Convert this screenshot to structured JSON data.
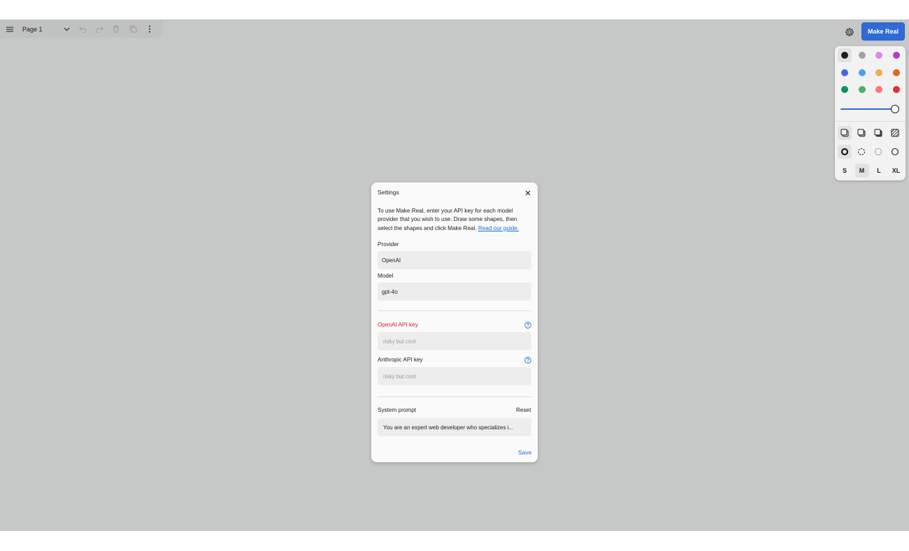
{
  "menu_bar": {
    "page_name": "Page 1"
  },
  "top_right": {
    "make_real_label": "Make Real"
  },
  "style_panel": {
    "colors": [
      "#1d1d1d",
      "#9ea3a8",
      "#e085e6",
      "#ae3ec9",
      "#4465e9",
      "#4ba1f1",
      "#f1ac4b",
      "#e16919",
      "#099268",
      "#4cb05e",
      "#f87777",
      "#e03131"
    ],
    "selected_color_index": 0,
    "opacity_level": 1.0,
    "sizes": [
      "S",
      "M",
      "L",
      "XL"
    ],
    "selected_size": "M"
  },
  "dialog": {
    "title": "Settings",
    "intro_text": "To use Make Real, enter your API key for each model provider that you wish to use. Draw some shapes, then select the shapes and click Make Real. ",
    "guide_link": "Read our guide.",
    "provider_label": "Provider",
    "provider_value": "OpenAI",
    "model_label": "Model",
    "model_value": "gpt-4o",
    "openai_key_label": "OpenAI API key",
    "openai_key_placeholder": "risky but cool",
    "anthropic_key_label": "Anthropic API key",
    "anthropic_key_placeholder": "risky but cool",
    "system_prompt_label": "System prompt",
    "reset_label": "Reset",
    "system_prompt_value": "You are an expert web developer who specializes i...",
    "save_label": "Save"
  }
}
